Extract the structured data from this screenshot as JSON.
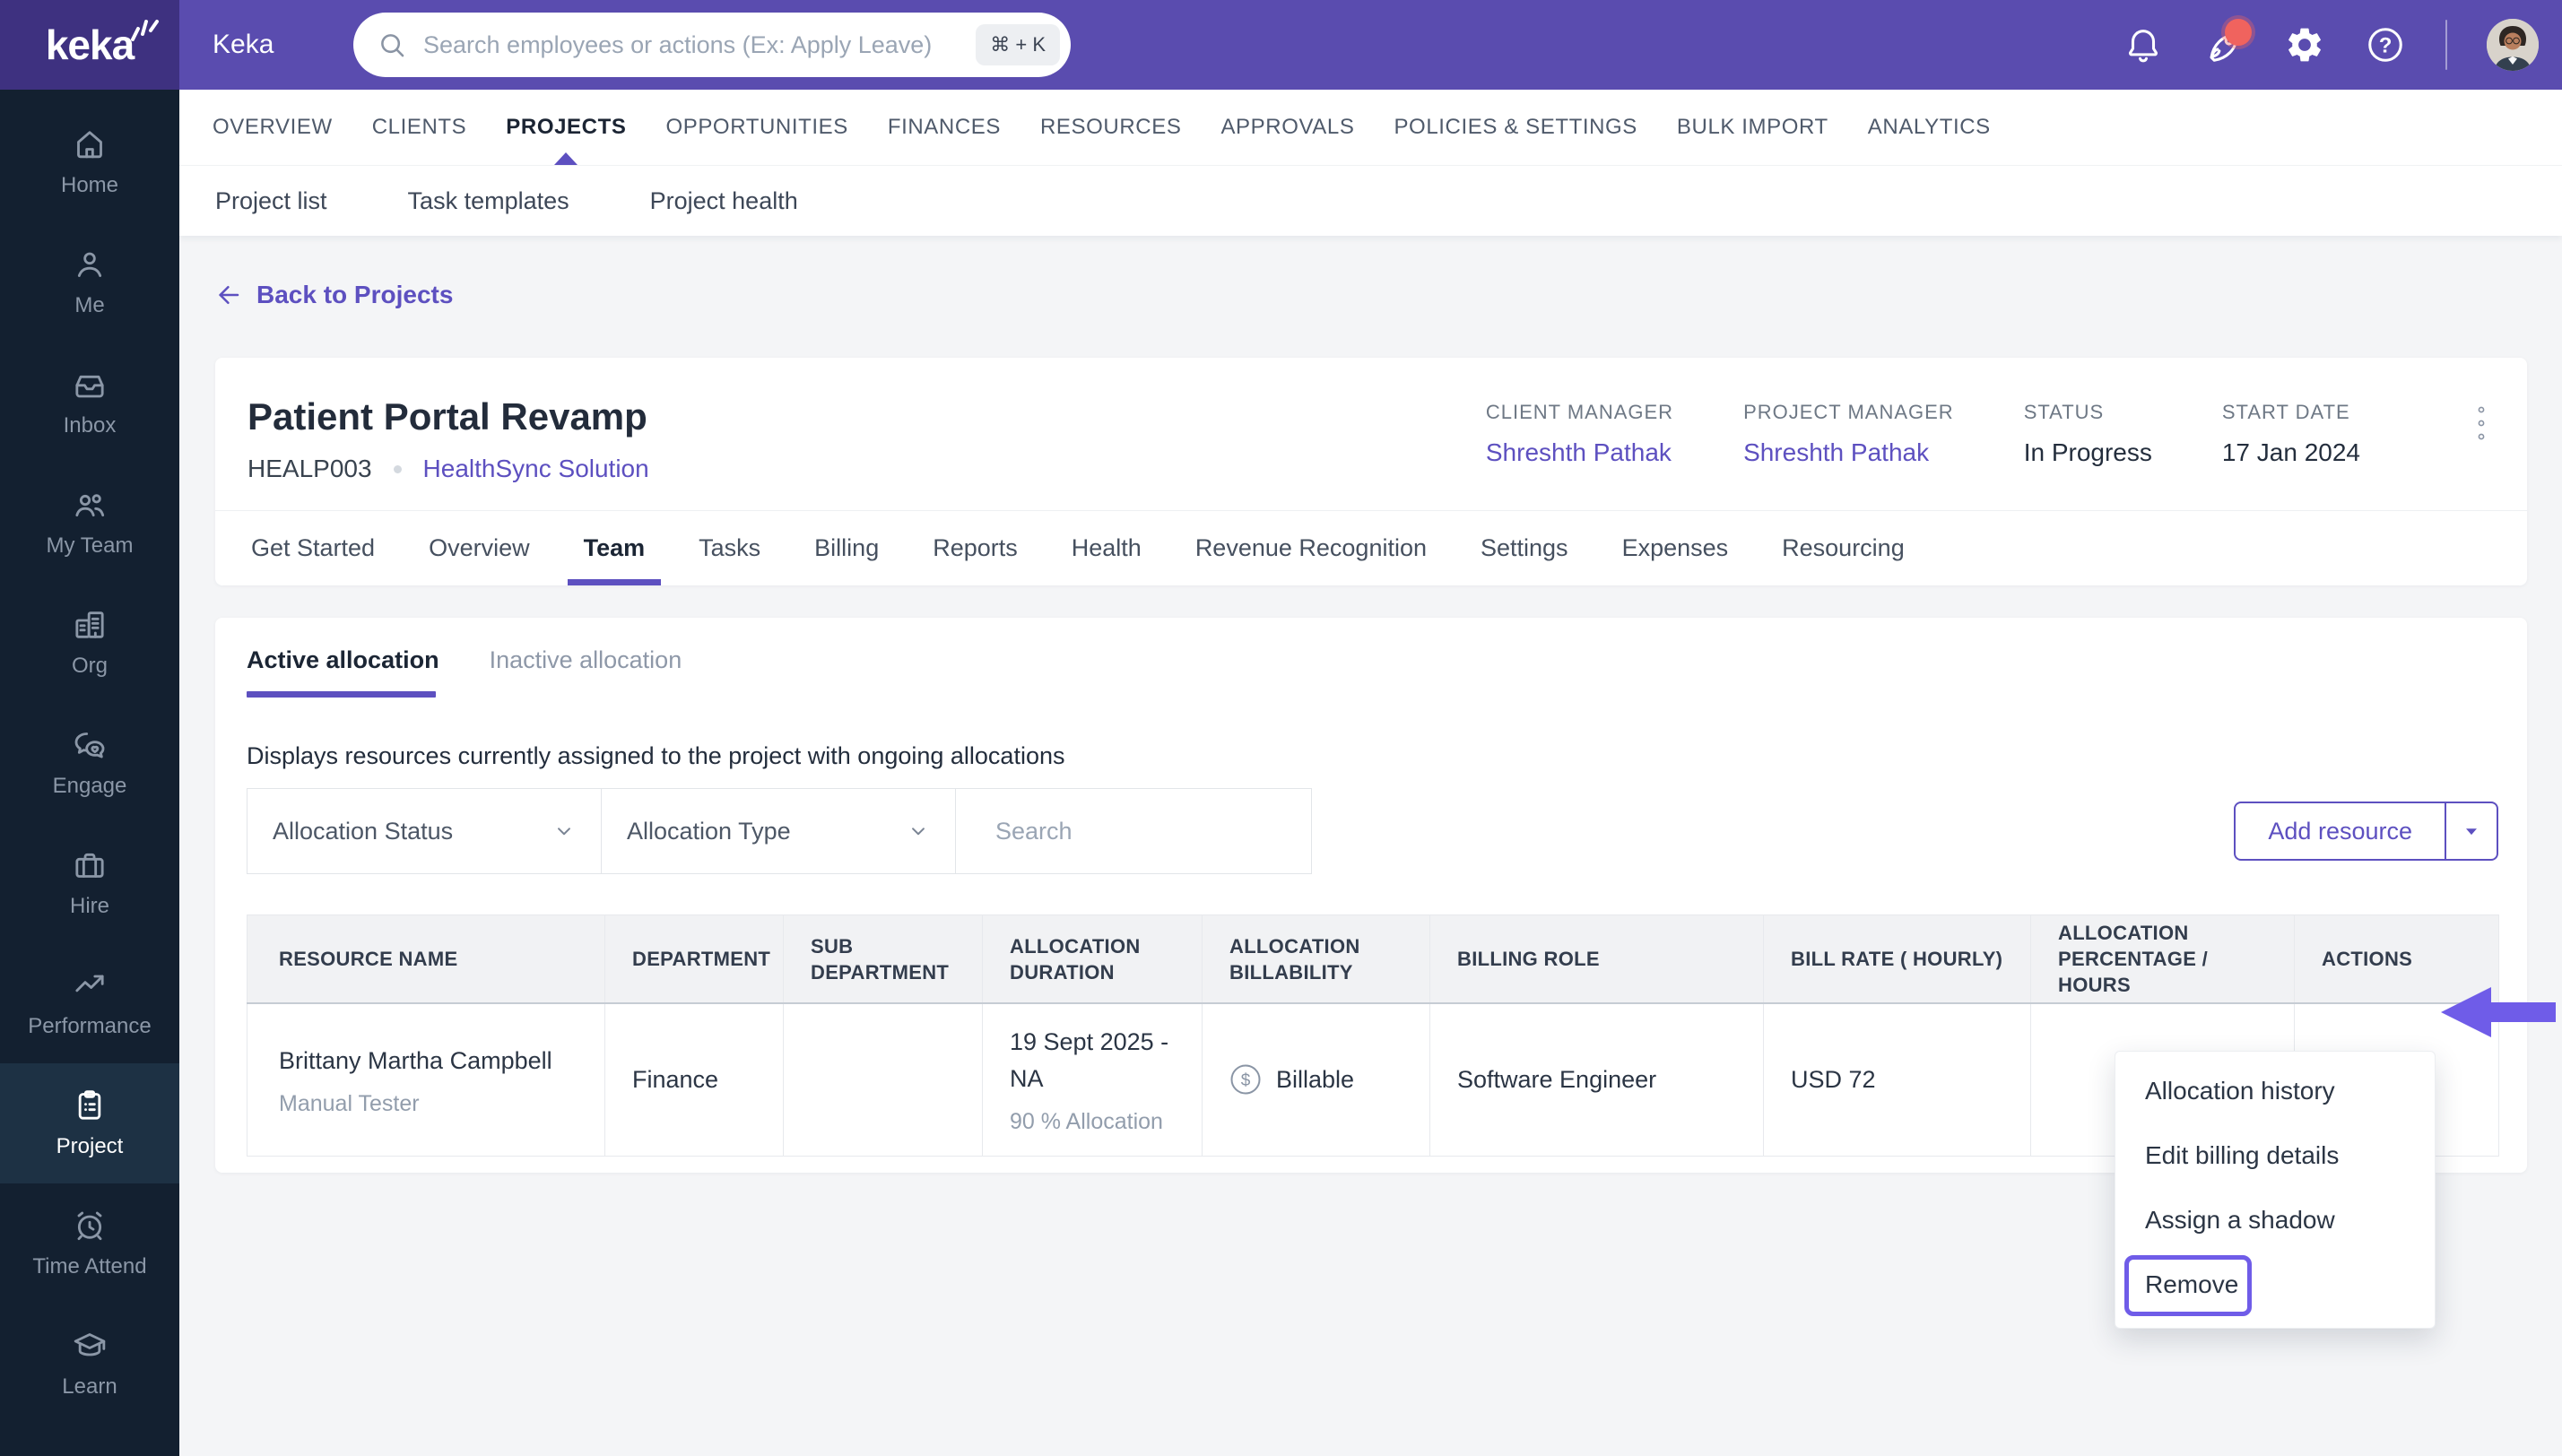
{
  "colors": {
    "topbar": "#5a4caf",
    "logo_bg": "#3e3180",
    "sidebar_bg": "#132030",
    "sidebar_active_bg": "#1d3144",
    "accent": "#5d50c0",
    "annotation": "#6f5ce8",
    "badge_red": "#f0635e",
    "content_bg": "#f4f5f7",
    "text_dark": "#232d3c",
    "text_gray": "#8e98a8",
    "table_header_bg": "#f1f2f4"
  },
  "topbar": {
    "brand": "keka",
    "app_label": "Keka",
    "search": {
      "placeholder": "Search employees or actions (Ex: Apply Leave)",
      "shortcut": "⌘ + K",
      "icon": "search-icon"
    },
    "icons": [
      {
        "name": "bell-icon"
      },
      {
        "name": "rocket-icon",
        "badge": true
      },
      {
        "name": "gear-icon"
      },
      {
        "name": "help-icon",
        "glyph": "?"
      }
    ],
    "avatar": "user-avatar"
  },
  "sidebar": {
    "items": [
      {
        "label": "Home",
        "icon": "home-icon",
        "active": false
      },
      {
        "label": "Me",
        "icon": "user-icon",
        "active": false
      },
      {
        "label": "Inbox",
        "icon": "inbox-icon",
        "active": false
      },
      {
        "label": "My Team",
        "icon": "team-icon",
        "active": false
      },
      {
        "label": "Org",
        "icon": "org-icon",
        "active": false
      },
      {
        "label": "Engage",
        "icon": "engage-icon",
        "active": false
      },
      {
        "label": "Hire",
        "icon": "briefcase-icon",
        "active": false
      },
      {
        "label": "Performance",
        "icon": "performance-icon",
        "active": false
      },
      {
        "label": "Project",
        "icon": "project-icon",
        "active": true
      },
      {
        "label": "Time Attend",
        "icon": "time-icon",
        "active": false
      },
      {
        "label": "Learn",
        "icon": "learn-icon",
        "active": false
      }
    ]
  },
  "nav": {
    "items": [
      {
        "label": "OVERVIEW",
        "active": false
      },
      {
        "label": "CLIENTS",
        "active": false
      },
      {
        "label": "PROJECTS",
        "active": true
      },
      {
        "label": "OPPORTUNITIES",
        "active": false
      },
      {
        "label": "FINANCES",
        "active": false
      },
      {
        "label": "RESOURCES",
        "active": false
      },
      {
        "label": "APPROVALS",
        "active": false
      },
      {
        "label": "POLICIES & SETTINGS",
        "active": false
      },
      {
        "label": "BULK IMPORT",
        "active": false
      },
      {
        "label": "ANALYTICS",
        "active": false
      }
    ]
  },
  "subnav": {
    "items": [
      {
        "label": "Project list"
      },
      {
        "label": "Task templates"
      },
      {
        "label": "Project health"
      }
    ]
  },
  "page": {
    "back_link": "Back to Projects"
  },
  "project": {
    "title": "Patient Portal Revamp",
    "code": "HEALP003",
    "client": "HealthSync Solution",
    "meta": [
      {
        "label": "CLIENT MANAGER",
        "value": "Shreshth Pathak"
      },
      {
        "label": "PROJECT MANAGER",
        "value": "Shreshth Pathak"
      },
      {
        "label": "STATUS",
        "value": "In Progress"
      },
      {
        "label": "START DATE",
        "value": "17 Jan 2024"
      }
    ],
    "tabs": [
      {
        "label": "Get Started",
        "active": false
      },
      {
        "label": "Overview",
        "active": false
      },
      {
        "label": "Team",
        "active": true
      },
      {
        "label": "Tasks",
        "active": false
      },
      {
        "label": "Billing",
        "active": false
      },
      {
        "label": "Reports",
        "active": false
      },
      {
        "label": "Health",
        "active": false
      },
      {
        "label": "Revenue Recognition",
        "active": false
      },
      {
        "label": "Settings",
        "active": false
      },
      {
        "label": "Expenses",
        "active": false
      },
      {
        "label": "Resourcing",
        "active": false
      }
    ]
  },
  "team": {
    "allocation_tabs": [
      {
        "label": "Active allocation",
        "active": true
      },
      {
        "label": "Inactive allocation",
        "active": false
      }
    ],
    "description": "Displays resources currently assigned to the project with ongoing allocations",
    "filters": {
      "status_label": "Allocation Status",
      "type_label": "Allocation Type",
      "search_placeholder": "Search"
    },
    "add_resource": {
      "label": "Add resource"
    },
    "table": {
      "columns": [
        "RESOURCE NAME",
        "DEPARTMENT",
        "SUB DEPARTMENT",
        "ALLOCATION DURATION",
        "ALLOCATION BILLABILITY",
        "BILLING ROLE",
        "BILL RATE ( HOURLY)",
        "ALLOCATION PERCENTAGE / HOURS",
        "ACTIONS"
      ],
      "row": {
        "name": "Brittany Martha Campbell",
        "role": "Manual Tester",
        "department": "Finance",
        "sub_department": "",
        "duration": "19 Sept 2025 - NA",
        "allocation": "90 % Allocation",
        "billability": "Billable",
        "billability_glyph": "$",
        "billing_role": "Software Engineer",
        "bill_rate": "USD 72",
        "allocation_percentage": ""
      },
      "row_actions": [
        "pencil-icon",
        "ellipsis-icon"
      ]
    }
  },
  "context_menu": {
    "items": [
      {
        "label": "Allocation history",
        "highlighted": false
      },
      {
        "label": "Edit billing details",
        "highlighted": false
      },
      {
        "label": "Assign a shadow",
        "highlighted": false
      },
      {
        "label": "Remove",
        "highlighted": true
      }
    ]
  }
}
